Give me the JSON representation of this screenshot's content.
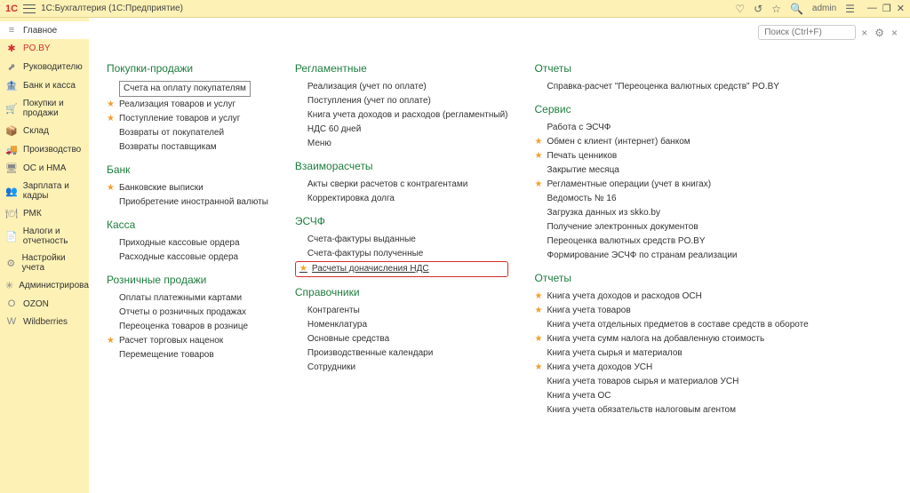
{
  "titlebar": {
    "logo": "1C",
    "app_title": "1С:Бухгалтерия  (1С:Предприятие)",
    "user": "admin"
  },
  "sidebar": [
    {
      "icon": "≡",
      "label": "Главное",
      "cls": "main"
    },
    {
      "icon": "✱",
      "label": "PO.BY",
      "cls": "active"
    },
    {
      "icon": "⬈",
      "label": "Руководителю"
    },
    {
      "icon": "🏦",
      "label": "Банк и касса"
    },
    {
      "icon": "🛒",
      "label": "Покупки и продажи"
    },
    {
      "icon": "📦",
      "label": "Склад"
    },
    {
      "icon": "🚚",
      "label": "Производство"
    },
    {
      "icon": "🖥",
      "label": "ОС и НМА"
    },
    {
      "icon": "👥",
      "label": "Зарплата и кадры"
    },
    {
      "icon": "🍽",
      "label": "РМК"
    },
    {
      "icon": "📄",
      "label": "Налоги и отчетность"
    },
    {
      "icon": "⚙",
      "label": "Настройки учета"
    },
    {
      "icon": "✳",
      "label": "Администрирование"
    },
    {
      "icon": "O",
      "label": "OZON"
    },
    {
      "icon": "W",
      "label": "Wildberries"
    }
  ],
  "search": {
    "placeholder": "Поиск (Ctrl+F)"
  },
  "col1": {
    "s1": {
      "title": "Покупки-продажи",
      "items": [
        {
          "star": false,
          "label": "Счета на оплату покупателям",
          "boxed": true
        },
        {
          "star": true,
          "label": "Реализация товаров и услуг"
        },
        {
          "star": true,
          "label": "Поступление товаров и услуг"
        },
        {
          "star": false,
          "label": "Возвраты от покупателей"
        },
        {
          "star": false,
          "label": "Возвраты поставщикам"
        }
      ]
    },
    "s2": {
      "title": "Банк",
      "items": [
        {
          "star": true,
          "label": "Банковские выписки"
        },
        {
          "star": false,
          "label": "Приобретение иностранной валюты"
        }
      ]
    },
    "s3": {
      "title": "Касса",
      "items": [
        {
          "star": false,
          "label": "Приходные кассовые ордера"
        },
        {
          "star": false,
          "label": "Расходные кассовые ордера"
        }
      ]
    },
    "s4": {
      "title": "Розничные продажи",
      "items": [
        {
          "star": false,
          "label": "Оплаты платежными картами"
        },
        {
          "star": false,
          "label": "Отчеты о розничных продажах"
        },
        {
          "star": false,
          "label": "Переоценка товаров в рознице"
        },
        {
          "star": true,
          "label": "Расчет торговых наценок"
        },
        {
          "star": false,
          "label": "Перемещение товаров"
        }
      ]
    }
  },
  "col2": {
    "s1": {
      "title": "Регламентные",
      "items": [
        {
          "star": false,
          "label": "Реализация (учет по оплате)"
        },
        {
          "star": false,
          "label": "Поступления (учет по оплате)"
        },
        {
          "star": false,
          "label": "Книга учета доходов и расходов (регламентный)"
        },
        {
          "star": false,
          "label": "НДС 60 дней"
        },
        {
          "star": false,
          "label": "Меню"
        }
      ]
    },
    "s2": {
      "title": "Взаиморасчеты",
      "items": [
        {
          "star": false,
          "label": "Акты сверки расчетов с контрагентами"
        },
        {
          "star": false,
          "label": "Корректировка долга"
        }
      ]
    },
    "s3": {
      "title": "ЭСЧФ",
      "items": [
        {
          "star": false,
          "label": "Счета-фактуры выданные"
        },
        {
          "star": false,
          "label": "Счета-фактуры полученные"
        },
        {
          "star": true,
          "label": "Расчеты доначисления НДС",
          "highlighted": true
        }
      ]
    },
    "s4": {
      "title": "Справочники",
      "items": [
        {
          "star": false,
          "label": "Контрагенты"
        },
        {
          "star": false,
          "label": "Номенклатура"
        },
        {
          "star": false,
          "label": "Основные средства"
        },
        {
          "star": false,
          "label": "Производственные календари"
        },
        {
          "star": false,
          "label": "Сотрудники"
        }
      ]
    }
  },
  "col3": {
    "s1": {
      "title": "Отчеты",
      "items": [
        {
          "star": false,
          "label": "Справка-расчет \"Переоценка валютных средств\" PO.BY"
        }
      ]
    },
    "s2": {
      "title": "Сервис",
      "items": [
        {
          "star": false,
          "label": "Работа с ЭСЧФ"
        },
        {
          "star": true,
          "label": "Обмен с клиент (интернет) банком"
        },
        {
          "star": true,
          "label": "Печать ценников"
        },
        {
          "star": false,
          "label": "Закрытие месяца"
        },
        {
          "star": true,
          "label": "Регламентные операции (учет в книгах)"
        },
        {
          "star": false,
          "label": "Ведомость № 16"
        },
        {
          "star": false,
          "label": "Загрузка данных из skko.by"
        },
        {
          "star": false,
          "label": "Получение электронных документов"
        },
        {
          "star": false,
          "label": "Переоценка валютных средств PO.BY"
        },
        {
          "star": false,
          "label": "Формирование ЭСЧФ по странам реализации"
        }
      ]
    },
    "s3": {
      "title": "Отчеты",
      "items": [
        {
          "star": true,
          "label": "Книга учета доходов и расходов ОСН"
        },
        {
          "star": true,
          "label": "Книга учета товаров"
        },
        {
          "star": false,
          "label": "Книга учета отдельных предметов в составе средств в обороте"
        },
        {
          "star": true,
          "label": "Книга учета сумм налога на добавленную стоимость"
        },
        {
          "star": false,
          "label": "Книга учета сырья и материалов"
        },
        {
          "star": true,
          "label": "Книга учета доходов УСН"
        },
        {
          "star": false,
          "label": "Книга учета товаров сырья и материалов УСН"
        },
        {
          "star": false,
          "label": "Книга учета ОС"
        },
        {
          "star": false,
          "label": "Книга учета обязательств налоговым агентом"
        }
      ]
    }
  }
}
